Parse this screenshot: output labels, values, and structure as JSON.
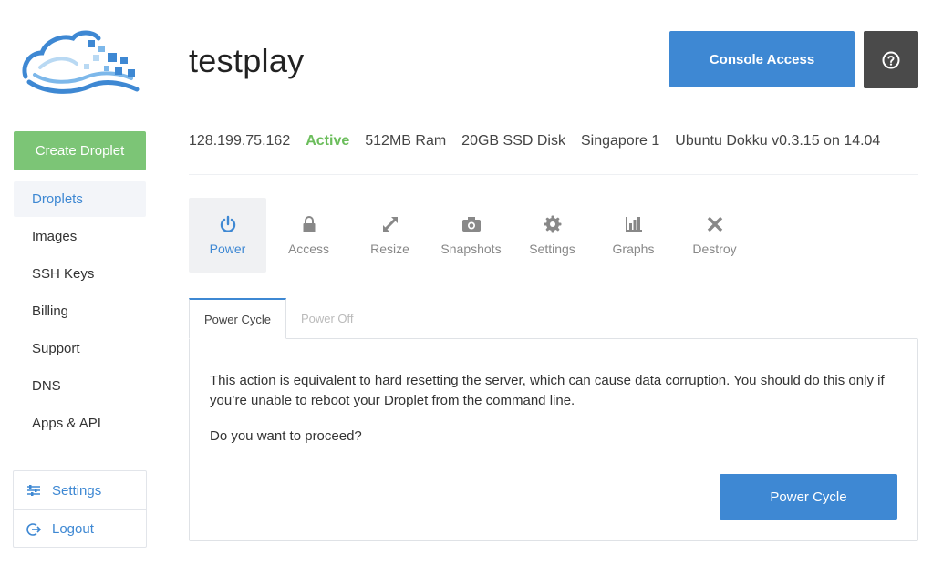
{
  "sidebar": {
    "create_label": "Create Droplet",
    "items": [
      {
        "label": "Droplets"
      },
      {
        "label": "Images"
      },
      {
        "label": "SSH Keys"
      },
      {
        "label": "Billing"
      },
      {
        "label": "Support"
      },
      {
        "label": "DNS"
      },
      {
        "label": "Apps & API"
      }
    ],
    "bottom": [
      {
        "label": "Settings",
        "icon": "sliders-icon"
      },
      {
        "label": "Logout",
        "icon": "logout-icon"
      }
    ]
  },
  "header": {
    "title": "testplay",
    "console_label": "Console Access",
    "help_icon": "question-circle-icon"
  },
  "info": {
    "ip": "128.199.75.162",
    "status": "Active",
    "ram": "512MB Ram",
    "disk": "20GB SSD Disk",
    "region": "Singapore 1",
    "image": "Ubuntu Dokku v0.3.15 on 14.04"
  },
  "actions": [
    {
      "label": "Power",
      "icon": "power-icon"
    },
    {
      "label": "Access",
      "icon": "lock-icon"
    },
    {
      "label": "Resize",
      "icon": "resize-icon"
    },
    {
      "label": "Snapshots",
      "icon": "camera-icon"
    },
    {
      "label": "Settings",
      "icon": "gear-icon"
    },
    {
      "label": "Graphs",
      "icon": "bar-chart-icon"
    },
    {
      "label": "Destroy",
      "icon": "x-icon"
    }
  ],
  "subtabs": [
    {
      "label": "Power Cycle"
    },
    {
      "label": "Power Off"
    }
  ],
  "panel": {
    "text1": "This action is equivalent to hard resetting the server, which can cause data corruption. You should do this only if you’re unable to reboot your Droplet from the command line.",
    "text2": "Do you want to proceed?",
    "button_label": "Power Cycle"
  },
  "colors": {
    "accent": "#3e88d3",
    "success": "#7cc576",
    "active_status": "#6bbd5b",
    "dark_button": "#4a4a4a"
  }
}
